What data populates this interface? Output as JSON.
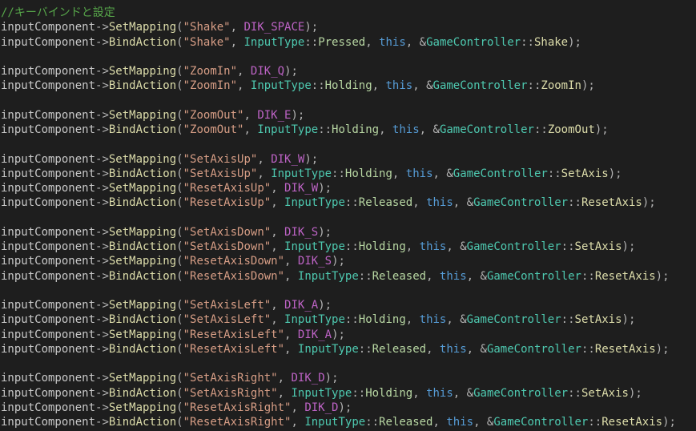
{
  "editor": {
    "colors": {
      "background": "#1e1e1e",
      "comment": "#57a64a",
      "identifier": "#c8c8c8",
      "function": "#dcdcaa",
      "string": "#d69d85",
      "macro": "#bd63c5",
      "type": "#4ec9b0",
      "keyword": "#569cd6",
      "enum": "#b8d7a3",
      "punctuation": "#b4b4b4"
    },
    "lines": [
      [
        {
          "t": "//キーバインドと設定",
          "c": "comment"
        }
      ],
      [
        {
          "t": "inputComponent",
          "c": "ident"
        },
        {
          "t": "->",
          "c": "punct"
        },
        {
          "t": "SetMapping",
          "c": "fn"
        },
        {
          "t": "(",
          "c": "punct"
        },
        {
          "t": "\"Shake\"",
          "c": "str"
        },
        {
          "t": ", ",
          "c": "punct"
        },
        {
          "t": "DIK_SPACE",
          "c": "macro"
        },
        {
          "t": ");",
          "c": "punct"
        }
      ],
      [
        {
          "t": "inputComponent",
          "c": "ident"
        },
        {
          "t": "->",
          "c": "punct"
        },
        {
          "t": "BindAction",
          "c": "fn"
        },
        {
          "t": "(",
          "c": "punct"
        },
        {
          "t": "\"Shake\"",
          "c": "str"
        },
        {
          "t": ", ",
          "c": "punct"
        },
        {
          "t": "InputType",
          "c": "type"
        },
        {
          "t": "::",
          "c": "punct"
        },
        {
          "t": "Pressed",
          "c": "enum"
        },
        {
          "t": ", ",
          "c": "punct"
        },
        {
          "t": "this",
          "c": "kw"
        },
        {
          "t": ", &",
          "c": "punct"
        },
        {
          "t": "GameController",
          "c": "type"
        },
        {
          "t": "::",
          "c": "punct"
        },
        {
          "t": "Shake",
          "c": "fn"
        },
        {
          "t": ");",
          "c": "punct"
        }
      ],
      [],
      [
        {
          "t": "inputComponent",
          "c": "ident"
        },
        {
          "t": "->",
          "c": "punct"
        },
        {
          "t": "SetMapping",
          "c": "fn"
        },
        {
          "t": "(",
          "c": "punct"
        },
        {
          "t": "\"ZoomIn\"",
          "c": "str"
        },
        {
          "t": ", ",
          "c": "punct"
        },
        {
          "t": "DIK_Q",
          "c": "macro"
        },
        {
          "t": ");",
          "c": "punct"
        }
      ],
      [
        {
          "t": "inputComponent",
          "c": "ident"
        },
        {
          "t": "->",
          "c": "punct"
        },
        {
          "t": "BindAction",
          "c": "fn"
        },
        {
          "t": "(",
          "c": "punct"
        },
        {
          "t": "\"ZoomIn\"",
          "c": "str"
        },
        {
          "t": ", ",
          "c": "punct"
        },
        {
          "t": "InputType",
          "c": "type"
        },
        {
          "t": "::",
          "c": "punct"
        },
        {
          "t": "Holding",
          "c": "enum"
        },
        {
          "t": ", ",
          "c": "punct"
        },
        {
          "t": "this",
          "c": "kw"
        },
        {
          "t": ", &",
          "c": "punct"
        },
        {
          "t": "GameController",
          "c": "type"
        },
        {
          "t": "::",
          "c": "punct"
        },
        {
          "t": "ZoomIn",
          "c": "fn"
        },
        {
          "t": ");",
          "c": "punct"
        }
      ],
      [],
      [
        {
          "t": "inputComponent",
          "c": "ident"
        },
        {
          "t": "->",
          "c": "punct"
        },
        {
          "t": "SetMapping",
          "c": "fn"
        },
        {
          "t": "(",
          "c": "punct"
        },
        {
          "t": "\"ZoomOut\"",
          "c": "str"
        },
        {
          "t": ", ",
          "c": "punct"
        },
        {
          "t": "DIK_E",
          "c": "macro"
        },
        {
          "t": ");",
          "c": "punct"
        }
      ],
      [
        {
          "t": "inputComponent",
          "c": "ident"
        },
        {
          "t": "->",
          "c": "punct"
        },
        {
          "t": "BindAction",
          "c": "fn"
        },
        {
          "t": "(",
          "c": "punct"
        },
        {
          "t": "\"ZoomOut\"",
          "c": "str"
        },
        {
          "t": ", ",
          "c": "punct"
        },
        {
          "t": "InputType",
          "c": "type"
        },
        {
          "t": "::",
          "c": "punct"
        },
        {
          "t": "Holding",
          "c": "enum"
        },
        {
          "t": ", ",
          "c": "punct"
        },
        {
          "t": "this",
          "c": "kw"
        },
        {
          "t": ", &",
          "c": "punct"
        },
        {
          "t": "GameController",
          "c": "type"
        },
        {
          "t": "::",
          "c": "punct"
        },
        {
          "t": "ZoomOut",
          "c": "fn"
        },
        {
          "t": ");",
          "c": "punct"
        }
      ],
      [],
      [
        {
          "t": "inputComponent",
          "c": "ident"
        },
        {
          "t": "->",
          "c": "punct"
        },
        {
          "t": "SetMapping",
          "c": "fn"
        },
        {
          "t": "(",
          "c": "punct"
        },
        {
          "t": "\"SetAxisUp\"",
          "c": "str"
        },
        {
          "t": ", ",
          "c": "punct"
        },
        {
          "t": "DIK_W",
          "c": "macro"
        },
        {
          "t": ");",
          "c": "punct"
        }
      ],
      [
        {
          "t": "inputComponent",
          "c": "ident"
        },
        {
          "t": "->",
          "c": "punct"
        },
        {
          "t": "BindAction",
          "c": "fn"
        },
        {
          "t": "(",
          "c": "punct"
        },
        {
          "t": "\"SetAxisUp\"",
          "c": "str"
        },
        {
          "t": ", ",
          "c": "punct"
        },
        {
          "t": "InputType",
          "c": "type"
        },
        {
          "t": "::",
          "c": "punct"
        },
        {
          "t": "Holding",
          "c": "enum"
        },
        {
          "t": ", ",
          "c": "punct"
        },
        {
          "t": "this",
          "c": "kw"
        },
        {
          "t": ", &",
          "c": "punct"
        },
        {
          "t": "GameController",
          "c": "type"
        },
        {
          "t": "::",
          "c": "punct"
        },
        {
          "t": "SetAxis",
          "c": "fn"
        },
        {
          "t": ");",
          "c": "punct"
        }
      ],
      [
        {
          "t": "inputComponent",
          "c": "ident"
        },
        {
          "t": "->",
          "c": "punct"
        },
        {
          "t": "SetMapping",
          "c": "fn"
        },
        {
          "t": "(",
          "c": "punct"
        },
        {
          "t": "\"ResetAxisUp\"",
          "c": "str"
        },
        {
          "t": ", ",
          "c": "punct"
        },
        {
          "t": "DIK_W",
          "c": "macro"
        },
        {
          "t": ");",
          "c": "punct"
        }
      ],
      [
        {
          "t": "inputComponent",
          "c": "ident"
        },
        {
          "t": "->",
          "c": "punct"
        },
        {
          "t": "BindAction",
          "c": "fn"
        },
        {
          "t": "(",
          "c": "punct"
        },
        {
          "t": "\"ResetAxisUp\"",
          "c": "str"
        },
        {
          "t": ", ",
          "c": "punct"
        },
        {
          "t": "InputType",
          "c": "type"
        },
        {
          "t": "::",
          "c": "punct"
        },
        {
          "t": "Released",
          "c": "enum"
        },
        {
          "t": ", ",
          "c": "punct"
        },
        {
          "t": "this",
          "c": "kw"
        },
        {
          "t": ", &",
          "c": "punct"
        },
        {
          "t": "GameController",
          "c": "type"
        },
        {
          "t": "::",
          "c": "punct"
        },
        {
          "t": "ResetAxis",
          "c": "fn"
        },
        {
          "t": ");",
          "c": "punct"
        }
      ],
      [],
      [
        {
          "t": "inputComponent",
          "c": "ident"
        },
        {
          "t": "->",
          "c": "punct"
        },
        {
          "t": "SetMapping",
          "c": "fn"
        },
        {
          "t": "(",
          "c": "punct"
        },
        {
          "t": "\"SetAxisDown\"",
          "c": "str"
        },
        {
          "t": ", ",
          "c": "punct"
        },
        {
          "t": "DIK_S",
          "c": "macro"
        },
        {
          "t": ");",
          "c": "punct"
        }
      ],
      [
        {
          "t": "inputComponent",
          "c": "ident"
        },
        {
          "t": "->",
          "c": "punct"
        },
        {
          "t": "BindAction",
          "c": "fn"
        },
        {
          "t": "(",
          "c": "punct"
        },
        {
          "t": "\"SetAxisDown\"",
          "c": "str"
        },
        {
          "t": ", ",
          "c": "punct"
        },
        {
          "t": "InputType",
          "c": "type"
        },
        {
          "t": "::",
          "c": "punct"
        },
        {
          "t": "Holding",
          "c": "enum"
        },
        {
          "t": ", ",
          "c": "punct"
        },
        {
          "t": "this",
          "c": "kw"
        },
        {
          "t": ", &",
          "c": "punct"
        },
        {
          "t": "GameController",
          "c": "type"
        },
        {
          "t": "::",
          "c": "punct"
        },
        {
          "t": "SetAxis",
          "c": "fn"
        },
        {
          "t": ");",
          "c": "punct"
        }
      ],
      [
        {
          "t": "inputComponent",
          "c": "ident"
        },
        {
          "t": "->",
          "c": "punct"
        },
        {
          "t": "SetMapping",
          "c": "fn"
        },
        {
          "t": "(",
          "c": "punct"
        },
        {
          "t": "\"ResetAxisDown\"",
          "c": "str"
        },
        {
          "t": ", ",
          "c": "punct"
        },
        {
          "t": "DIK_S",
          "c": "macro"
        },
        {
          "t": ");",
          "c": "punct"
        }
      ],
      [
        {
          "t": "inputComponent",
          "c": "ident"
        },
        {
          "t": "->",
          "c": "punct"
        },
        {
          "t": "BindAction",
          "c": "fn"
        },
        {
          "t": "(",
          "c": "punct"
        },
        {
          "t": "\"ResetAxisDown\"",
          "c": "str"
        },
        {
          "t": ", ",
          "c": "punct"
        },
        {
          "t": "InputType",
          "c": "type"
        },
        {
          "t": "::",
          "c": "punct"
        },
        {
          "t": "Released",
          "c": "enum"
        },
        {
          "t": ", ",
          "c": "punct"
        },
        {
          "t": "this",
          "c": "kw"
        },
        {
          "t": ", &",
          "c": "punct"
        },
        {
          "t": "GameController",
          "c": "type"
        },
        {
          "t": "::",
          "c": "punct"
        },
        {
          "t": "ResetAxis",
          "c": "fn"
        },
        {
          "t": ");",
          "c": "punct"
        }
      ],
      [],
      [
        {
          "t": "inputComponent",
          "c": "ident"
        },
        {
          "t": "->",
          "c": "punct"
        },
        {
          "t": "SetMapping",
          "c": "fn"
        },
        {
          "t": "(",
          "c": "punct"
        },
        {
          "t": "\"SetAxisLeft\"",
          "c": "str"
        },
        {
          "t": ", ",
          "c": "punct"
        },
        {
          "t": "DIK_A",
          "c": "macro"
        },
        {
          "t": ");",
          "c": "punct"
        }
      ],
      [
        {
          "t": "inputComponent",
          "c": "ident"
        },
        {
          "t": "->",
          "c": "punct"
        },
        {
          "t": "BindAction",
          "c": "fn"
        },
        {
          "t": "(",
          "c": "punct"
        },
        {
          "t": "\"SetAxisLeft\"",
          "c": "str"
        },
        {
          "t": ", ",
          "c": "punct"
        },
        {
          "t": "InputType",
          "c": "type"
        },
        {
          "t": "::",
          "c": "punct"
        },
        {
          "t": "Holding",
          "c": "enum"
        },
        {
          "t": ", ",
          "c": "punct"
        },
        {
          "t": "this",
          "c": "kw"
        },
        {
          "t": ", &",
          "c": "punct"
        },
        {
          "t": "GameController",
          "c": "type"
        },
        {
          "t": "::",
          "c": "punct"
        },
        {
          "t": "SetAxis",
          "c": "fn"
        },
        {
          "t": ");",
          "c": "punct"
        }
      ],
      [
        {
          "t": "inputComponent",
          "c": "ident"
        },
        {
          "t": "->",
          "c": "punct"
        },
        {
          "t": "SetMapping",
          "c": "fn"
        },
        {
          "t": "(",
          "c": "punct"
        },
        {
          "t": "\"ResetAxisLeft\"",
          "c": "str"
        },
        {
          "t": ", ",
          "c": "punct"
        },
        {
          "t": "DIK_A",
          "c": "macro"
        },
        {
          "t": ");",
          "c": "punct"
        }
      ],
      [
        {
          "t": "inputComponent",
          "c": "ident"
        },
        {
          "t": "->",
          "c": "punct"
        },
        {
          "t": "BindAction",
          "c": "fn"
        },
        {
          "t": "(",
          "c": "punct"
        },
        {
          "t": "\"ResetAxisLeft\"",
          "c": "str"
        },
        {
          "t": ", ",
          "c": "punct"
        },
        {
          "t": "InputType",
          "c": "type"
        },
        {
          "t": "::",
          "c": "punct"
        },
        {
          "t": "Released",
          "c": "enum"
        },
        {
          "t": ", ",
          "c": "punct"
        },
        {
          "t": "this",
          "c": "kw"
        },
        {
          "t": ", &",
          "c": "punct"
        },
        {
          "t": "GameController",
          "c": "type"
        },
        {
          "t": "::",
          "c": "punct"
        },
        {
          "t": "ResetAxis",
          "c": "fn"
        },
        {
          "t": ");",
          "c": "punct"
        }
      ],
      [],
      [
        {
          "t": "inputComponent",
          "c": "ident"
        },
        {
          "t": "->",
          "c": "punct"
        },
        {
          "t": "SetMapping",
          "c": "fn"
        },
        {
          "t": "(",
          "c": "punct"
        },
        {
          "t": "\"SetAxisRight\"",
          "c": "str"
        },
        {
          "t": ", ",
          "c": "punct"
        },
        {
          "t": "DIK_D",
          "c": "macro"
        },
        {
          "t": ");",
          "c": "punct"
        }
      ],
      [
        {
          "t": "inputComponent",
          "c": "ident"
        },
        {
          "t": "->",
          "c": "punct"
        },
        {
          "t": "BindAction",
          "c": "fn"
        },
        {
          "t": "(",
          "c": "punct"
        },
        {
          "t": "\"SetAxisRight\"",
          "c": "str"
        },
        {
          "t": ", ",
          "c": "punct"
        },
        {
          "t": "InputType",
          "c": "type"
        },
        {
          "t": "::",
          "c": "punct"
        },
        {
          "t": "Holding",
          "c": "enum"
        },
        {
          "t": ", ",
          "c": "punct"
        },
        {
          "t": "this",
          "c": "kw"
        },
        {
          "t": ", &",
          "c": "punct"
        },
        {
          "t": "GameController",
          "c": "type"
        },
        {
          "t": "::",
          "c": "punct"
        },
        {
          "t": "SetAxis",
          "c": "fn"
        },
        {
          "t": ");",
          "c": "punct"
        }
      ],
      [
        {
          "t": "inputComponent",
          "c": "ident"
        },
        {
          "t": "->",
          "c": "punct"
        },
        {
          "t": "SetMapping",
          "c": "fn"
        },
        {
          "t": "(",
          "c": "punct"
        },
        {
          "t": "\"ResetAxisRight\"",
          "c": "str"
        },
        {
          "t": ", ",
          "c": "punct"
        },
        {
          "t": "DIK_D",
          "c": "macro"
        },
        {
          "t": ");",
          "c": "punct"
        }
      ],
      [
        {
          "t": "inputComponent",
          "c": "ident"
        },
        {
          "t": "->",
          "c": "punct"
        },
        {
          "t": "BindAction",
          "c": "fn"
        },
        {
          "t": "(",
          "c": "punct"
        },
        {
          "t": "\"ResetAxisRight\"",
          "c": "str"
        },
        {
          "t": ", ",
          "c": "punct"
        },
        {
          "t": "InputType",
          "c": "type"
        },
        {
          "t": "::",
          "c": "punct"
        },
        {
          "t": "Released",
          "c": "enum"
        },
        {
          "t": ", ",
          "c": "punct"
        },
        {
          "t": "this",
          "c": "kw"
        },
        {
          "t": ", &",
          "c": "punct"
        },
        {
          "t": "GameController",
          "c": "type"
        },
        {
          "t": "::",
          "c": "punct"
        },
        {
          "t": "ResetAxis",
          "c": "fn"
        },
        {
          "t": ");",
          "c": "punct"
        }
      ]
    ]
  }
}
